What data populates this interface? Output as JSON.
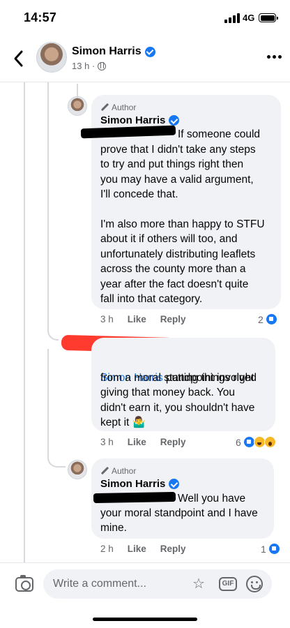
{
  "status_bar": {
    "time": "14:57",
    "network": "4G"
  },
  "header": {
    "name": "Simon Harris",
    "meta": "13 h ·"
  },
  "comments": [
    {
      "author_tag": "Author",
      "name": "Simon Harris",
      "text_after_redaction": "If someone could",
      "text": "prove that I didn't take any steps\nto try and put things right then\nyou may have a valid argument,\nI'll concede that.\n\nI'm also more than happy to STFU\nabout it if others will too, and\nunfortunately distributing leaflets\nacross the county more than a\nyear after the fact doesn't quite\nfall into that category.",
      "time": "3 h",
      "like": "Like",
      "reply": "Reply",
      "reactions": "2"
    },
    {
      "mention": "Simon Harris",
      "text_first": " putting things right",
      "text": "from a moral standpoint involved\ngiving that money back. You\ndidn't earn it, you shouldn't have\nkept it 🤷‍♂️",
      "time": "3 h",
      "like": "Like",
      "reply": "Reply",
      "reactions": "6"
    },
    {
      "author_tag": "Author",
      "name": "Simon Harris",
      "text_after_redaction": "Well you have",
      "text": "your moral standpoint and I have\nmine.",
      "time": "2 h",
      "like": "Like",
      "reply": "Reply",
      "reactions": "1"
    }
  ],
  "composer": {
    "placeholder": "Write a comment..."
  },
  "icons": {
    "back": "chevron-left-icon",
    "verified": "verified-badge-icon",
    "globe": "globe-icon",
    "more": "more-dots-icon",
    "camera": "camera-icon",
    "sticker": "sticker-icon",
    "gif": "GIF",
    "emoji": "emoji-icon"
  },
  "colors": {
    "accent": "#1877f2",
    "bubble": "#f0f2f5",
    "muted": "#65676b",
    "redaction_red": "#ff3b2f"
  }
}
